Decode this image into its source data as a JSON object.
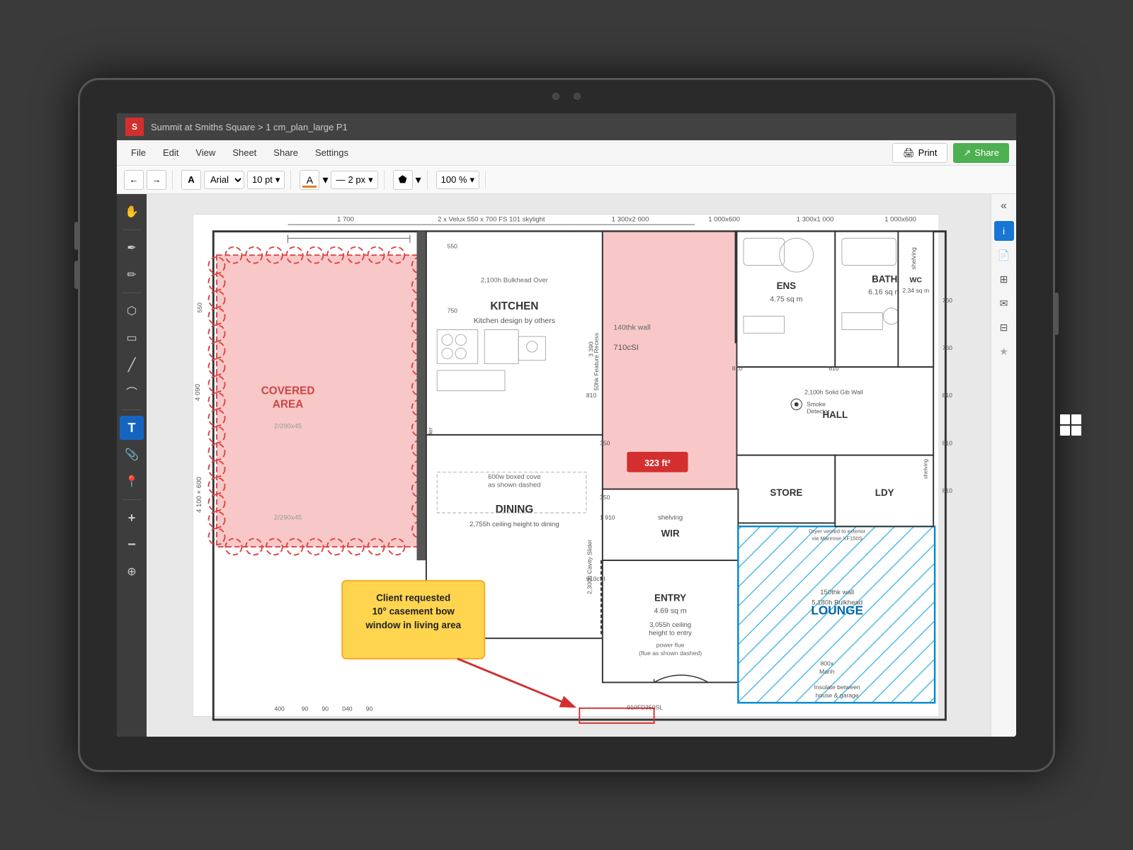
{
  "device": {
    "camera_dots": 2
  },
  "header": {
    "logo_text": "S",
    "breadcrumb": "Summit at Smiths Square > 1 cm_plan_large P1"
  },
  "menubar": {
    "items": [
      "File",
      "Edit",
      "View",
      "Sheet",
      "Share",
      "Settings"
    ],
    "print_label": "Print",
    "share_label": "Share"
  },
  "toolbar": {
    "font_name": "Arial",
    "font_size": "10 pt",
    "zoom": "100 %",
    "stroke_size": "2 px"
  },
  "left_tools": [
    {
      "name": "hand",
      "icon": "✋",
      "active": false
    },
    {
      "name": "pen",
      "icon": "✏️",
      "active": false
    },
    {
      "name": "pencil",
      "icon": "🖊",
      "active": false
    },
    {
      "name": "select",
      "icon": "⬚",
      "active": false
    },
    {
      "name": "rectangle",
      "icon": "▭",
      "active": false
    },
    {
      "name": "line",
      "icon": "/",
      "active": false
    },
    {
      "name": "curve",
      "icon": "⌒",
      "active": false
    },
    {
      "name": "text",
      "icon": "T",
      "active": true
    },
    {
      "name": "attach",
      "icon": "📎",
      "active": false
    },
    {
      "name": "location",
      "icon": "📍",
      "active": false
    },
    {
      "name": "plus",
      "icon": "+",
      "active": false
    },
    {
      "name": "minus",
      "icon": "−",
      "active": false
    },
    {
      "name": "crosshair",
      "icon": "⊕",
      "active": false
    }
  ],
  "right_sidebar_icons": [
    {
      "name": "info",
      "icon": "i",
      "active": true
    },
    {
      "name": "document",
      "icon": "📄",
      "active": false
    },
    {
      "name": "grid",
      "icon": "⊞",
      "active": false
    },
    {
      "name": "mail",
      "icon": "✉",
      "active": false
    },
    {
      "name": "table",
      "icon": "⊟",
      "active": false
    },
    {
      "name": "star",
      "icon": "★",
      "active": false
    }
  ],
  "annotation": {
    "callout_text": "Client requested 10° casement bow window in living area",
    "area_badge": "323 ft²"
  },
  "floorplan": {
    "rooms": [
      {
        "label": "KITCHEN",
        "sublabel": "Kitchen design by others"
      },
      {
        "label": "DINING",
        "sublabel": "2,755h ceiling height to dining"
      },
      {
        "label": "COVERED AREA",
        "sublabel": ""
      },
      {
        "label": "ENS",
        "sublabel": "4.75 sq m"
      },
      {
        "label": "BATH",
        "sublabel": "6.16 sq m"
      },
      {
        "label": "WC",
        "sublabel": "2.34 sq m"
      },
      {
        "label": "HALL",
        "sublabel": ""
      },
      {
        "label": "STORE",
        "sublabel": ""
      },
      {
        "label": "WIR",
        "sublabel": ""
      },
      {
        "label": "LOUNGE",
        "sublabel": ""
      },
      {
        "label": "ENTRY",
        "sublabel": "4.69 sq m"
      },
      {
        "label": "LDY",
        "sublabel": ""
      }
    ],
    "annotations": [
      "2 x Velux 550 x 700 FS 101 skylight",
      "1 300x2 000",
      "2,100h Bulkhead Over",
      "140thk wall",
      "710cSI",
      "50hk Feature Recess",
      "3 390",
      "2,100h Solid Gib Wall",
      "shelving",
      "Smoke Detector",
      "5,180h Bulkhead",
      "150thk wall",
      "Dryer vented to exterior via Manrose XF150S",
      "800x Manh",
      "Insulate between house & garage",
      "910FD350SL",
      "Stacker Slider",
      "2,300h Cavity Slider",
      "600w boxed cove as shown dashed",
      "2/290x45",
      "2/290x45",
      "1 700",
      "1 300x1 000",
      "1 000x600",
      "1 000x600"
    ]
  }
}
